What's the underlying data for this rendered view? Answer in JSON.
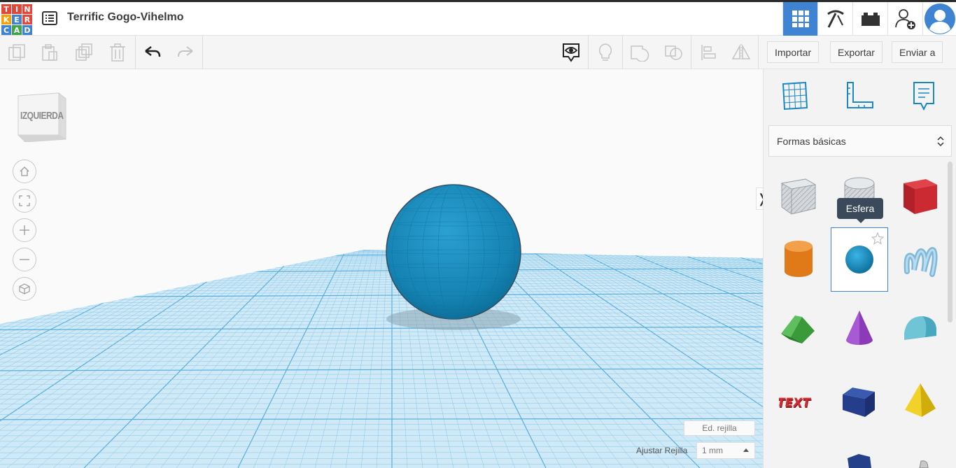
{
  "app": {
    "logo_letters": [
      "T",
      "I",
      "N",
      "K",
      "E",
      "R",
      "C",
      "A",
      "D"
    ],
    "logo_colors": [
      "#e2473a",
      "#e2473a",
      "#e2473a",
      "#f7a000",
      "#3f83d3",
      "#e2473a",
      "#3f83d3",
      "#3aa54a",
      "#3f83d3"
    ],
    "title": "Terrific Gogo-Vihelmo"
  },
  "topright": {
    "items": [
      {
        "name": "3d-design-grid-icon",
        "active": true
      },
      {
        "name": "pickaxe-icon",
        "active": false
      },
      {
        "name": "bricks-icon",
        "active": false
      },
      {
        "name": "add-user-icon",
        "active": false
      },
      {
        "name": "avatar",
        "active": false
      }
    ]
  },
  "toolbar": {
    "import_label": "Importar",
    "export_label": "Exportar",
    "send_label": "Enviar a"
  },
  "canvas": {
    "viewcube_label": "IZQUIERDA",
    "nav_buttons": [
      "home-icon",
      "fit-view-icon",
      "zoom-in-icon",
      "zoom-out-icon",
      "ortho-cube-icon"
    ],
    "grid_edit_label": "Ed. rejilla",
    "snap_label": "Ajustar Rejilla",
    "snap_value": "1 mm"
  },
  "panel": {
    "category": "Formas básicas",
    "tooltip": "Esfera",
    "shapes": [
      {
        "name": "shape-box-hole",
        "label": "Caja agujero"
      },
      {
        "name": "shape-cylinder-hole",
        "label": "Cilindro agujero"
      },
      {
        "name": "shape-box",
        "label": "Caja"
      },
      {
        "name": "shape-cylinder",
        "label": "Cilindro"
      },
      {
        "name": "shape-sphere",
        "label": "Esfera"
      },
      {
        "name": "shape-scribble",
        "label": "Garabato"
      },
      {
        "name": "shape-roof",
        "label": "Techo"
      },
      {
        "name": "shape-cone",
        "label": "Cono"
      },
      {
        "name": "shape-round-roof",
        "label": "Techo redondo"
      },
      {
        "name": "shape-text",
        "label": "Texto"
      },
      {
        "name": "shape-prism",
        "label": "Prisma"
      },
      {
        "name": "shape-pyramid",
        "label": "Pirámide"
      }
    ],
    "colors": {
      "accent": "#3f83d3",
      "sphere": "#1a87b8",
      "grid": "#5fb9e0"
    }
  }
}
